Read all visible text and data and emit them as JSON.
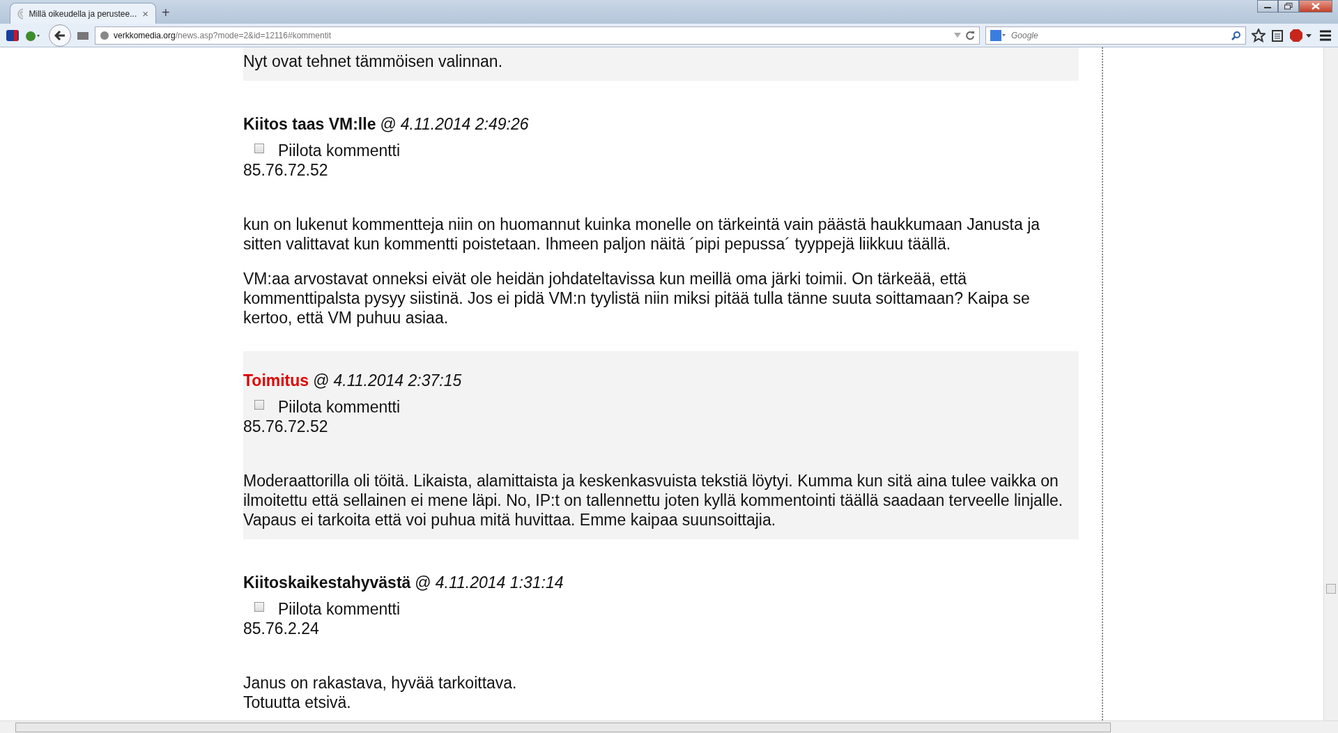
{
  "browser": {
    "tab": {
      "title": "Millä oikeudella ja perustee...",
      "close": "×",
      "selected": true
    },
    "new_tab": "+",
    "url": {
      "domain": "verkkomedia.org",
      "path": "/news.asp?mode=2&id=12116#kommentit"
    },
    "search": {
      "placeholder": "Google"
    }
  },
  "comments": [
    {
      "kind": "partial",
      "shaded": true,
      "body": [
        "Nyt ovat tehnet tämmöisen valinnan."
      ]
    },
    {
      "kind": "full",
      "shaded": false,
      "author": "Kiitos taas VM:lle",
      "editor": false,
      "at": "@",
      "date": "4.11.2014 2:49:26",
      "hide_label": "Piilota kommentti",
      "checked": false,
      "ip": "85.76.72.52",
      "body": [
        "kun on lukenut kommentteja niin on huomannut kuinka monelle on tärkeintä vain päästä haukkumaan Janusta ja sitten valittavat kun kommentti poistetaan. Ihmeen paljon näitä ´pipi pepussa´ tyyppejä liikkuu täällä.",
        "VM:aa arvostavat onneksi eivät ole heidän johdateltavissa kun meillä oma järki toimii. On tärkeää, että kommenttipalsta pysyy siistinä. Jos ei pidä VM:n tyylistä niin miksi pitää tulla tänne suuta soittamaan? Kaipa se kertoo, että VM puhuu asiaa."
      ]
    },
    {
      "kind": "full",
      "shaded": true,
      "author": "Toimitus",
      "editor": true,
      "at": "@",
      "date": "4.11.2014 2:37:15",
      "hide_label": "Piilota kommentti",
      "checked": false,
      "ip": "85.76.72.52",
      "body": [
        "Moderaattorilla oli töitä. Likaista, alamittaista ja keskenkasvuista tekstiä löytyi. Kumma kun sitä aina tulee vaikka on ilmoitettu että sellainen ei mene läpi. No, IP:t on tallennettu joten kyllä kommentointi täällä saadaan terveelle linjalle. Vapaus ei tarkoita että voi puhua mitä huvittaa. Emme kaipaa suunsoittajia."
      ]
    },
    {
      "kind": "full",
      "shaded": false,
      "author": "Kiitoskaikestahyvästä",
      "editor": false,
      "at": "@",
      "date": "4.11.2014 1:31:14",
      "hide_label": "Piilota kommentti",
      "checked": false,
      "ip": "85.76.2.24",
      "body": [
        "Janus on rakastava, hyvää tarkoittava.\nTotuutta etsivä."
      ]
    }
  ]
}
